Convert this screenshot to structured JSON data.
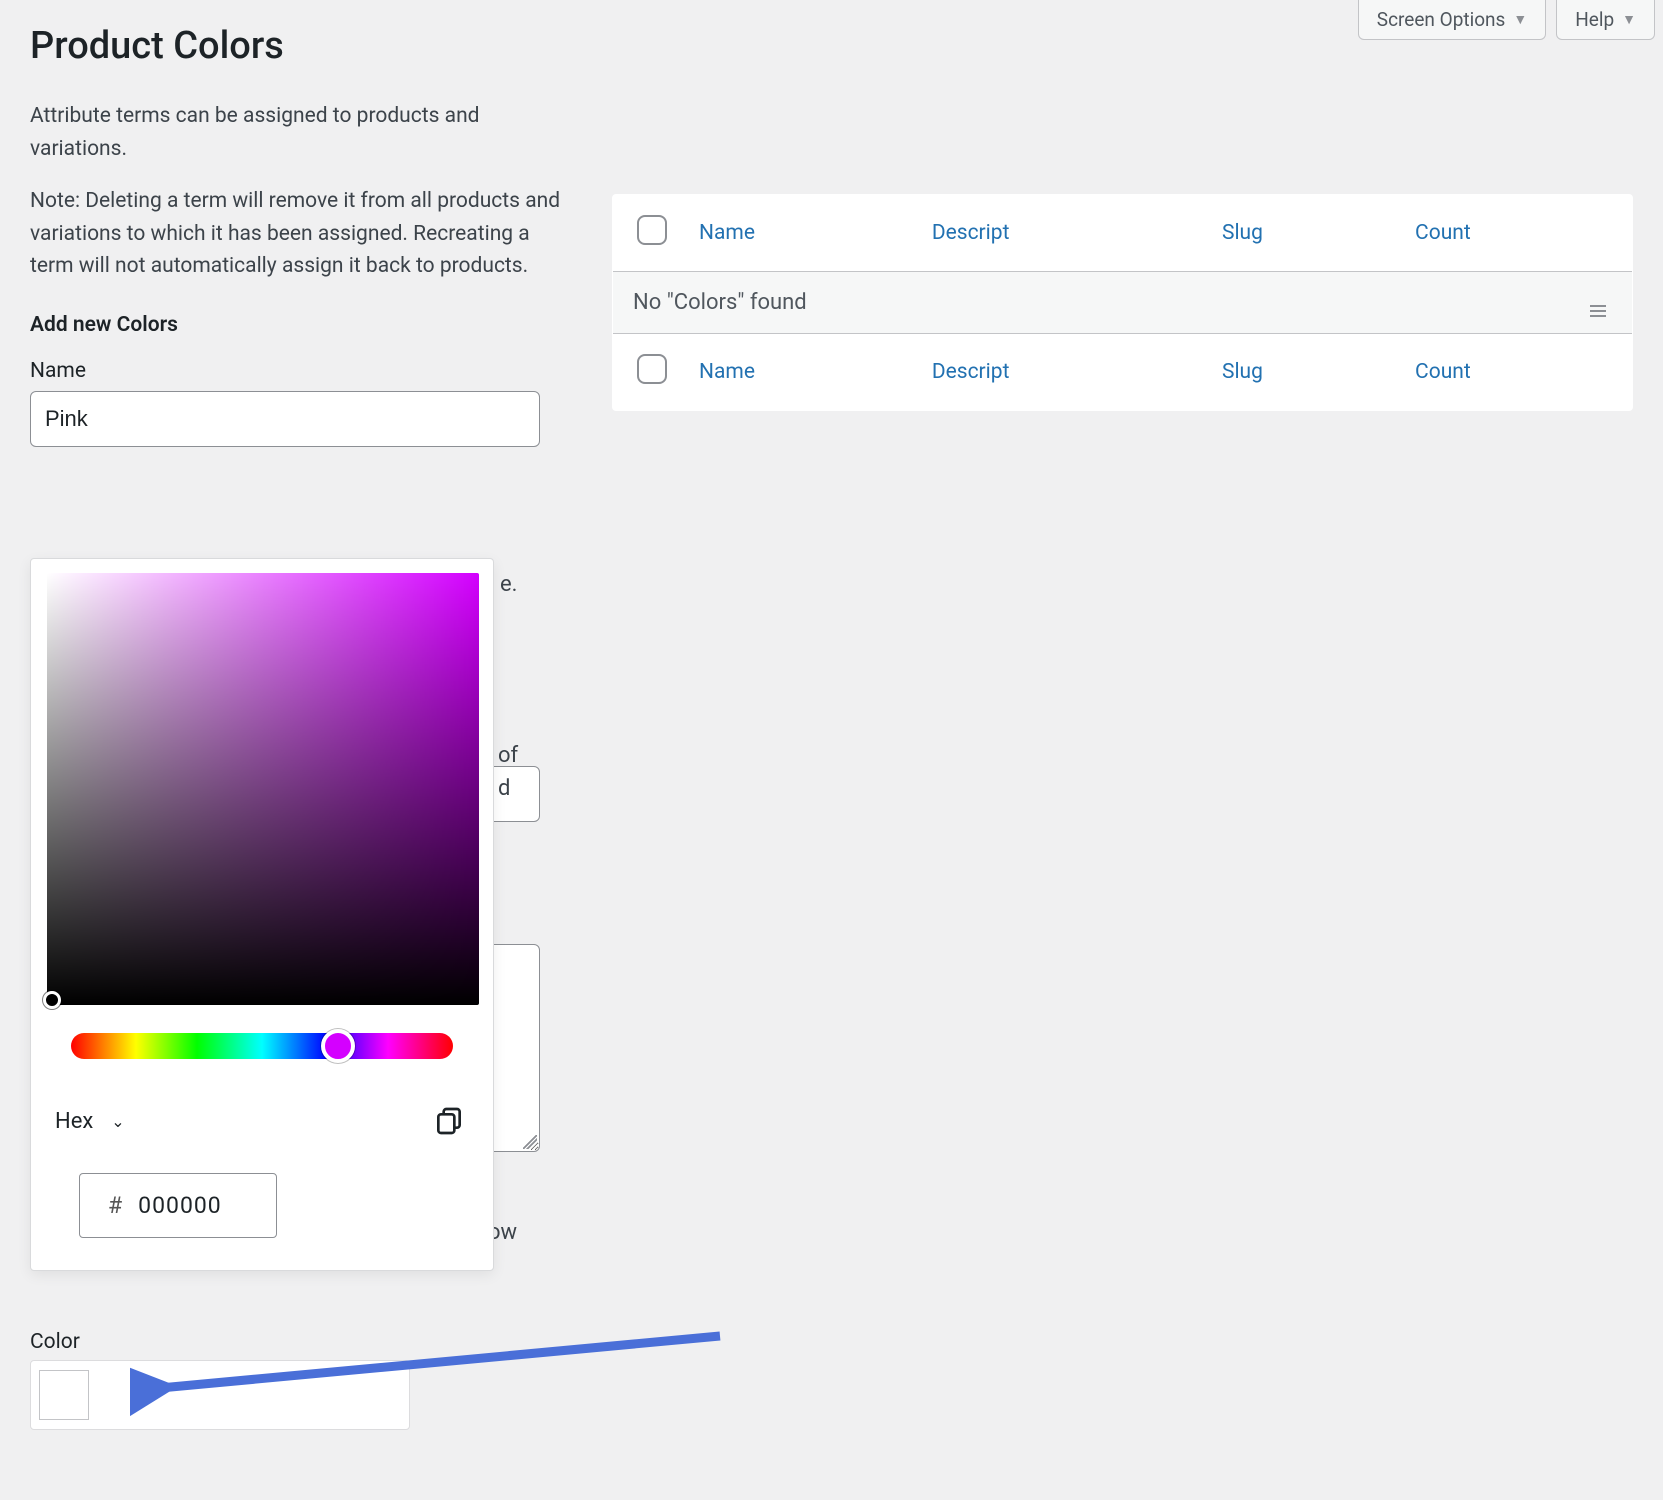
{
  "header": {
    "screen_options_label": "Screen Options",
    "help_label": "Help"
  },
  "page_title": "Product Colors",
  "intro": {
    "p1": "Attribute terms can be assigned to products and variations.",
    "p2": "Note: Deleting a term will remove it from all products and variations to which it has been assigned. Recreating a term will not automatically assign it back to products."
  },
  "form": {
    "section_heading": "Add new Colors",
    "name_label": "Name",
    "name_value": "Pink",
    "hidden_fragment_e": "e.",
    "hidden_fragment_of": "of\nd",
    "hidden_fragment_ow": "ow",
    "color_label": "Color"
  },
  "picker": {
    "format_label": "Hex",
    "hash": "#",
    "hex_value": "000000"
  },
  "table": {
    "columns": {
      "name": "Name",
      "description": "Descript",
      "slug": "Slug",
      "count": "Count"
    },
    "empty_message": "No \"Colors\" found"
  }
}
